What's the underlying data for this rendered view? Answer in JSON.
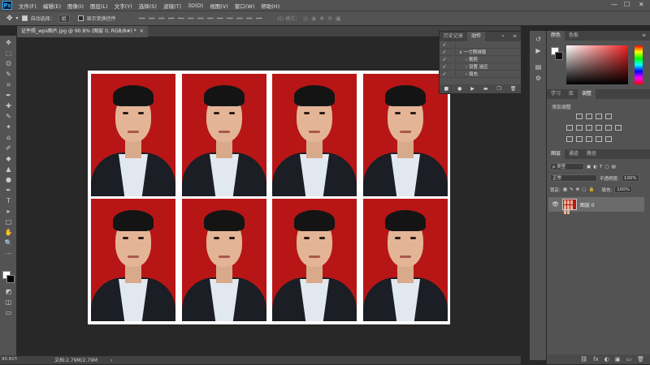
{
  "menubar": {
    "app_icon": "Ps",
    "items": [
      "文件(F)",
      "编辑(E)",
      "图像(I)",
      "图层(L)",
      "文字(Y)",
      "选择(S)",
      "滤镜(T)",
      "3D(D)",
      "视图(V)",
      "窗口(W)",
      "帮助(H)"
    ],
    "minimize_glyph": "—",
    "maximize_glyph": "☐",
    "close_glyph": "✕"
  },
  "options": {
    "auto_select_label": "自动选择：",
    "auto_select_value": "组",
    "show_transform_label": "显示变换控件",
    "mode_3d_label": "3D 模式："
  },
  "document": {
    "tab_title": "证件照_wps图片.jpg @ 90.8% (图层 0, RGB/8#) *",
    "tab_close": "×",
    "zoom": "90.81%",
    "doc_size": "文档:2.79M/2.79M",
    "photo_rows": 2,
    "photo_cols": 4
  },
  "history_panel": {
    "tabs": [
      "历史记录",
      "动作"
    ],
    "rows": [
      {
        "check": "✓",
        "label": ""
      },
      {
        "check": "✓",
        "label": "∨ 一寸照排版"
      },
      {
        "check": "✓",
        "label": "› 裁剪"
      },
      {
        "check": "✓",
        "label": "› 设置 选区"
      },
      {
        "check": "✓",
        "label": "› 填充"
      }
    ],
    "footer_icons": [
      "■",
      "●",
      "▶",
      "▬",
      "❐",
      "🗑"
    ]
  },
  "color_panel": {
    "tabs": [
      "颜色",
      "色板"
    ],
    "fg_color": "#ffffff",
    "bg_color": "#111111"
  },
  "adjust_panel": {
    "tabs": [
      "学习",
      "库",
      "调整"
    ],
    "title": "添加调整"
  },
  "layers_panel": {
    "tabs": [
      "图层",
      "通道",
      "路径"
    ],
    "kind_label": "类型",
    "blend_mode": "正常",
    "opacity_label": "不透明度:",
    "opacity_value": "100%",
    "lock_label": "锁定:",
    "fill_label": "填充:",
    "fill_value": "100%",
    "layer_name": "图层 0",
    "footer_icons": [
      "fx",
      "◐",
      "▣",
      "▭",
      "🗑"
    ]
  },
  "tools": [
    "✥",
    "⬚",
    "ʘ",
    "✎",
    "⌗",
    "✒",
    "✚",
    "✎",
    "✦",
    "⌂",
    "✐",
    "◆",
    "▲",
    "●",
    "✒",
    "T",
    "▸",
    "□",
    "✋",
    "🔍",
    "⋯",
    "◩",
    "◫",
    "▭"
  ],
  "side_icons": [
    "↺",
    "▶",
    "▤",
    "⚙",
    "✧",
    "◫"
  ]
}
